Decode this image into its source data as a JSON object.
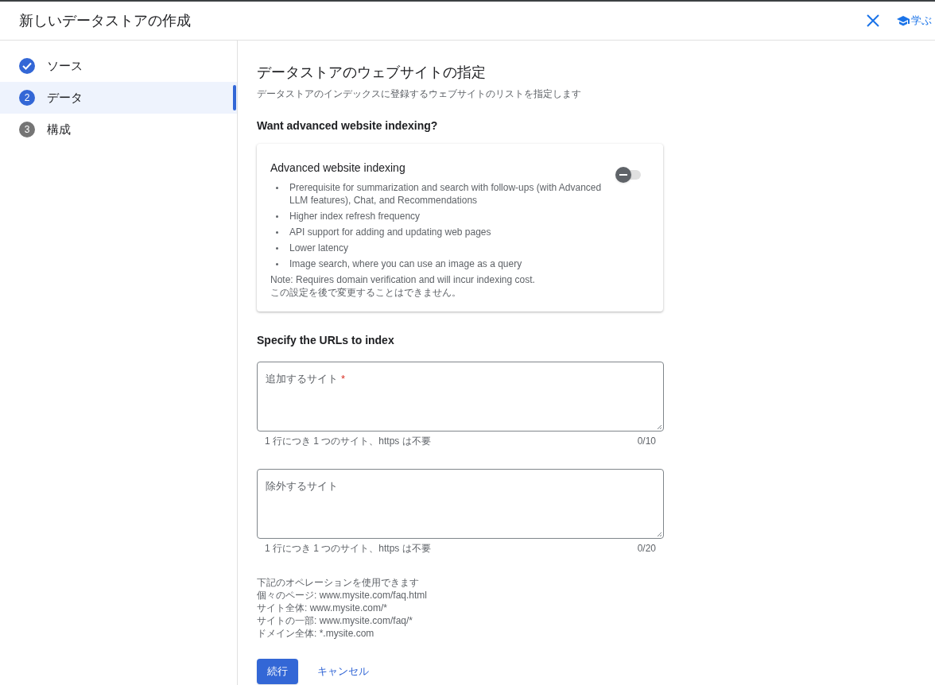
{
  "header": {
    "title": "新しいデータストアの作成",
    "learn_label": "学ぶ"
  },
  "steps": [
    {
      "label": "ソース",
      "completed": true,
      "selected": false
    },
    {
      "number": "2",
      "label": "データ",
      "completed": false,
      "selected": true
    },
    {
      "number": "3",
      "label": "構成",
      "completed": false,
      "selected": false
    }
  ],
  "main": {
    "title": "データストアのウェブサイトの指定",
    "subtitle": "データストアのインデックスに登録するウェブサイトのリストを指定します",
    "advanced_heading": "Want advanced website indexing?",
    "card": {
      "title": "Advanced website indexing",
      "on": false,
      "bullets": [
        "Prerequisite for summarization and search with follow-ups (with Advanced LLM features), Chat, and Recommendations",
        "Higher index refresh frequency",
        "API support for adding and updating web pages",
        "Lower latency",
        "Image search, where you can use an image as a query"
      ],
      "notes": [
        "Note: Requires domain verification and will incur indexing cost.",
        "この設定を後で変更することはできません。"
      ]
    },
    "urls_heading": "Specify the URLs to index",
    "fields": [
      {
        "placeholder": "追加するサイト",
        "required_mark": "*",
        "hint": "1 行につき 1 つのサイト、https は不要",
        "counter": "0/10"
      },
      {
        "placeholder": "除外するサイト",
        "hint": "1 行につき 1 つのサイト、https は不要",
        "counter": "0/20"
      }
    ],
    "operations": [
      "下記のオペレーションを使用できます",
      "個々のページ: www.mysite.com/faq.html",
      "サイト全体: www.mysite.com/*",
      "サイトの一部: www.mysite.com/faq/*",
      "ドメイン全体: *.mysite.com"
    ],
    "buttons": [
      {
        "kind": "primary",
        "label": "続行"
      },
      {
        "kind": "text",
        "label": "キャンセル"
      }
    ]
  }
}
